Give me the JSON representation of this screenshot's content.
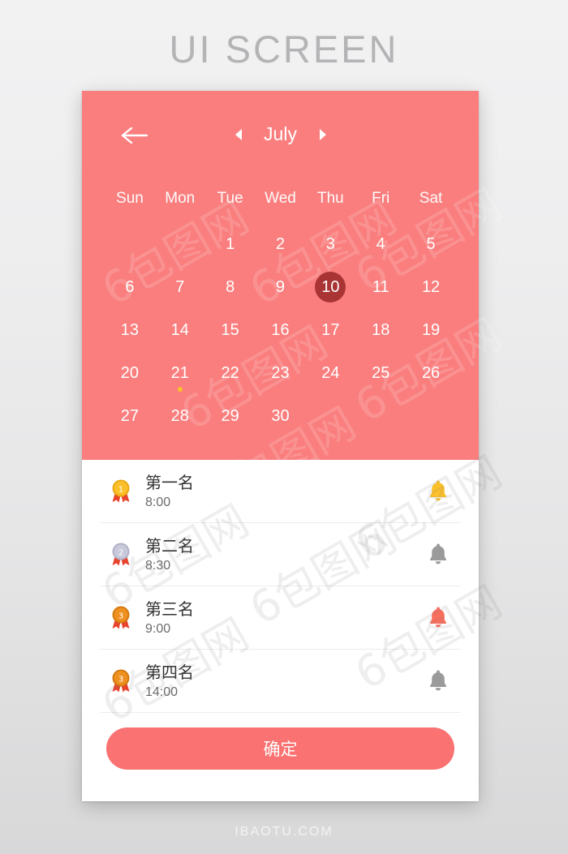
{
  "page": {
    "title": "UI SCREEN",
    "footer": "IBAOTU.COM",
    "watermark": "6包图网"
  },
  "colors": {
    "coral": "#FA7E7E",
    "selected_day": "#A93434",
    "button": "#FA7272",
    "gold": "#FCC02A",
    "silver": "#C6C6D8",
    "bronze": "#E8881E",
    "ribbon": "#E8442E",
    "title_text": "#B4B4B6",
    "row_title": "#333333",
    "row_time": "#6B6B6B"
  },
  "calendar": {
    "back_icon": "arrow-left-icon",
    "prev_icon": "triangle-left-icon",
    "next_icon": "triangle-right-icon",
    "month": "July",
    "weekdays": [
      "Sun",
      "Mon",
      "Tue",
      "Wed",
      "Thu",
      "Fri",
      "Sat"
    ],
    "leading_blanks": 2,
    "days": [
      1,
      2,
      3,
      4,
      5,
      6,
      7,
      8,
      9,
      10,
      11,
      12,
      13,
      14,
      15,
      16,
      17,
      18,
      19,
      20,
      21,
      22,
      23,
      24,
      25,
      26,
      27,
      28,
      29,
      30
    ],
    "selected_day": 10,
    "dotted_days": [
      21
    ]
  },
  "list": {
    "rows": [
      {
        "medal": "medal-gold-icon",
        "rank": "1",
        "title": "第一名",
        "time": "8:00",
        "bell": "bell-icon",
        "bell_state": "gold"
      },
      {
        "medal": "medal-silver-icon",
        "rank": "2",
        "title": "第二名",
        "time": "8:30",
        "bell": "bell-icon",
        "bell_state": "gray"
      },
      {
        "medal": "medal-bronze-icon",
        "rank": "3",
        "title": "第三名",
        "time": "9:00",
        "bell": "bell-icon",
        "bell_state": "coral"
      },
      {
        "medal": "medal-bronze-icon",
        "rank": "3",
        "title": "第四名",
        "time": "14:00",
        "bell": "bell-icon",
        "bell_state": "gray"
      }
    ]
  },
  "confirm": {
    "label": "确定"
  }
}
